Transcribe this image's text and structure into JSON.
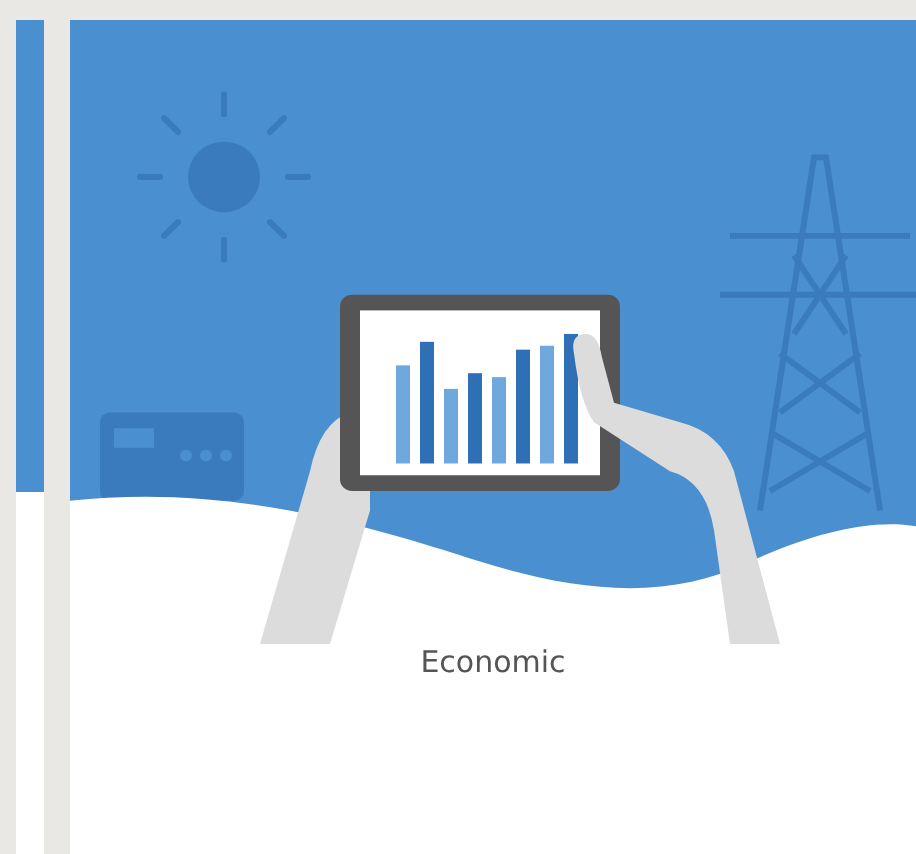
{
  "card": {
    "title": "Economic"
  }
}
